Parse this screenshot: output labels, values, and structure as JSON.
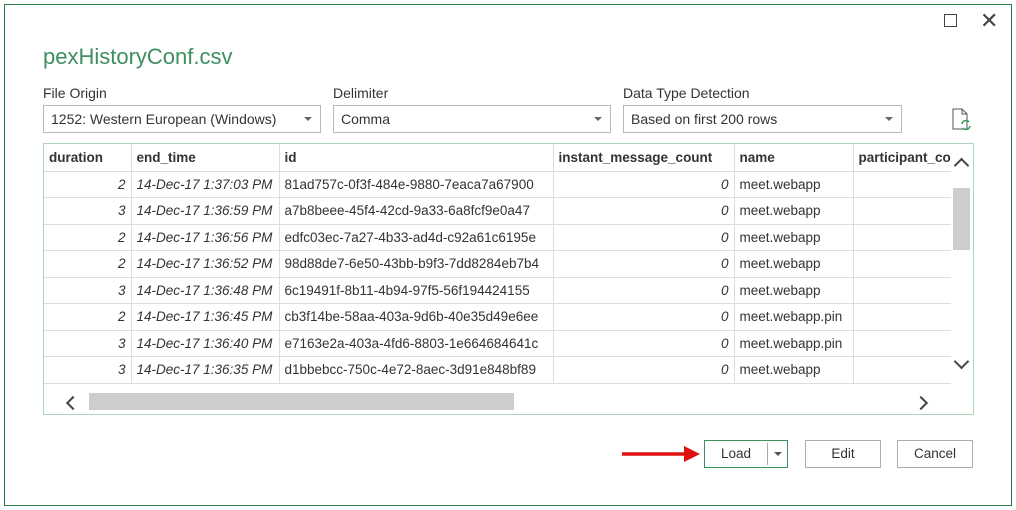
{
  "dialog": {
    "title": "pexHistoryConf.csv",
    "maximize_icon": "maximize-icon",
    "close_icon": "close-icon"
  },
  "options": {
    "file_origin": {
      "label": "File Origin",
      "value": "1252: Western European (Windows)"
    },
    "delimiter": {
      "label": "Delimiter",
      "value": "Comma"
    },
    "detection": {
      "label": "Data Type Detection",
      "value": "Based on first 200 rows"
    },
    "refresh_icon": "refresh-file-icon"
  },
  "table": {
    "columns": [
      "duration",
      "end_time",
      "id",
      "instant_message_count",
      "name",
      "participant_co"
    ],
    "rows": [
      [
        "2",
        "14-Dec-17 1:37:03 PM",
        "81ad757c-0f3f-484e-9880-7eaca7a67900",
        "0",
        "meet.webapp",
        ""
      ],
      [
        "3",
        "14-Dec-17 1:36:59 PM",
        "a7b8beee-45f4-42cd-9a33-6a8fcf9e0a47",
        "0",
        "meet.webapp",
        ""
      ],
      [
        "2",
        "14-Dec-17 1:36:56 PM",
        "edfc03ec-7a27-4b33-ad4d-c92a61c6195e",
        "0",
        "meet.webapp",
        ""
      ],
      [
        "2",
        "14-Dec-17 1:36:52 PM",
        "98d88de7-6e50-43bb-b9f3-7dd8284eb7b4",
        "0",
        "meet.webapp",
        ""
      ],
      [
        "3",
        "14-Dec-17 1:36:48 PM",
        "6c19491f-8b11-4b94-97f5-56f194424155",
        "0",
        "meet.webapp",
        ""
      ],
      [
        "2",
        "14-Dec-17 1:36:45 PM",
        "cb3f14be-58aa-403a-9d6b-40e35d49e6ee",
        "0",
        "meet.webapp.pin",
        ""
      ],
      [
        "3",
        "14-Dec-17 1:36:40 PM",
        "e7163e2a-403a-4fd6-8803-1e664684641c",
        "0",
        "meet.webapp.pin",
        ""
      ],
      [
        "3",
        "14-Dec-17 1:36:35 PM",
        "d1bbebcc-750c-4e72-8aec-3d91e848bf89",
        "0",
        "meet.webapp",
        ""
      ]
    ]
  },
  "footer": {
    "load": "Load",
    "edit": "Edit",
    "cancel": "Cancel"
  },
  "colors": {
    "accent": "#3d8f5f",
    "arrow": "#e01010"
  }
}
